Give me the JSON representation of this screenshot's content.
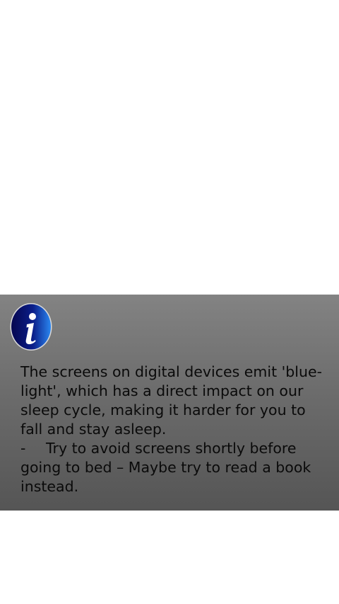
{
  "info_panel": {
    "icon": "info-icon",
    "message": "The screens on digital devices emit 'blue-light', which has a direct impact on our sleep cycle, making it harder for you to fall and stay asleep.",
    "tip_bullet": "-",
    "tip": "Try to avoid screens shortly before going to bed – Maybe try to read a book instead."
  },
  "colors": {
    "background": "#ffffff",
    "panel_top": "#838383",
    "panel_bottom": "#555555",
    "icon_dark": "#0a0a6e",
    "icon_light": "#1e6fe0",
    "text": "#0a0a0a"
  }
}
